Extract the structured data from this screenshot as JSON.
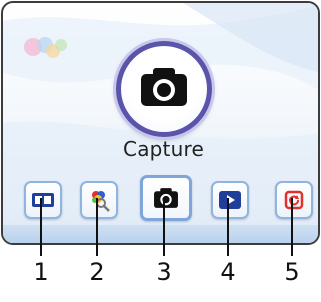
{
  "main": {
    "mode_label": "Capture",
    "mode_icon": "camera-icon"
  },
  "toolbar": {
    "buttons": [
      {
        "icon": "film-strip-icon",
        "callout": "1"
      },
      {
        "icon": "color-magnifier-icon",
        "callout": "2"
      },
      {
        "icon": "camera-icon",
        "callout": "3",
        "selected": true
      },
      {
        "icon": "play-icon",
        "callout": "4"
      },
      {
        "icon": "rotate-icon",
        "callout": "5"
      }
    ]
  },
  "colors": {
    "ring": "#5a55a8",
    "button_border": "#8fb4e0",
    "play_blue": "#1f3f9a",
    "rotate_red": "#e0322c"
  }
}
